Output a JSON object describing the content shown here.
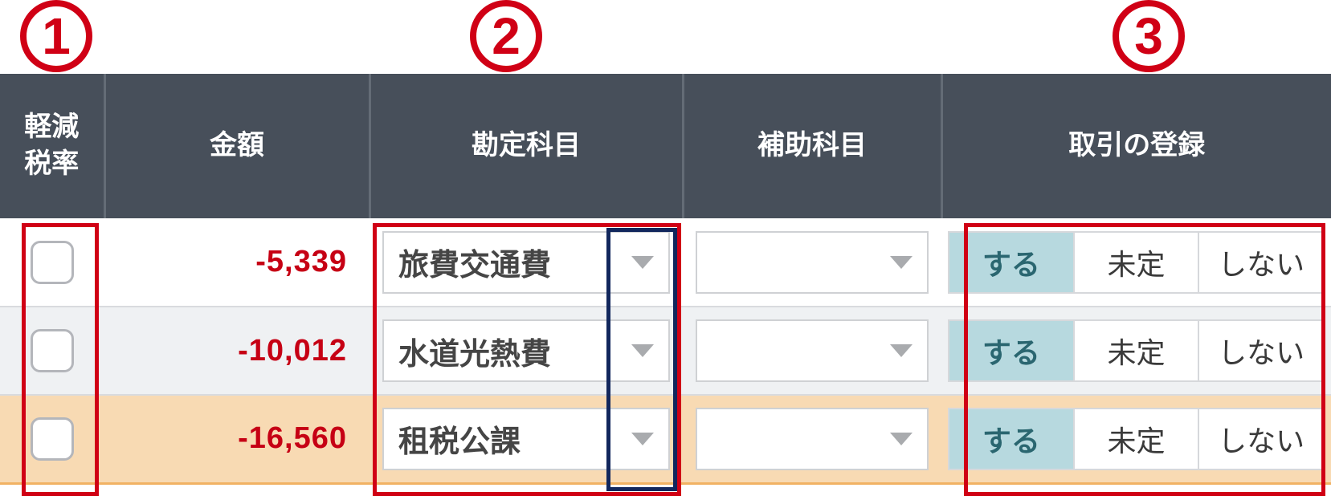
{
  "annotations": {
    "badge1": "1",
    "badge2": "2",
    "badge3": "3"
  },
  "columns": {
    "reduced_rate": "軽減\n税率",
    "amount": "金額",
    "account": "勘定科目",
    "sub_account": "補助科目",
    "register": "取引の登録"
  },
  "segment_options": {
    "do": "する",
    "undecided": "未定",
    "dont": "しない"
  },
  "rows": [
    {
      "reduced_checked": false,
      "amount": "-5,339",
      "account": "旅費交通費",
      "sub_account": "",
      "register_selected": "do"
    },
    {
      "reduced_checked": false,
      "amount": "-10,012",
      "account": "水道光熱費",
      "sub_account": "",
      "register_selected": "do"
    },
    {
      "reduced_checked": false,
      "amount": "-16,560",
      "account": "租税公課",
      "sub_account": "",
      "register_selected": "do"
    }
  ]
}
